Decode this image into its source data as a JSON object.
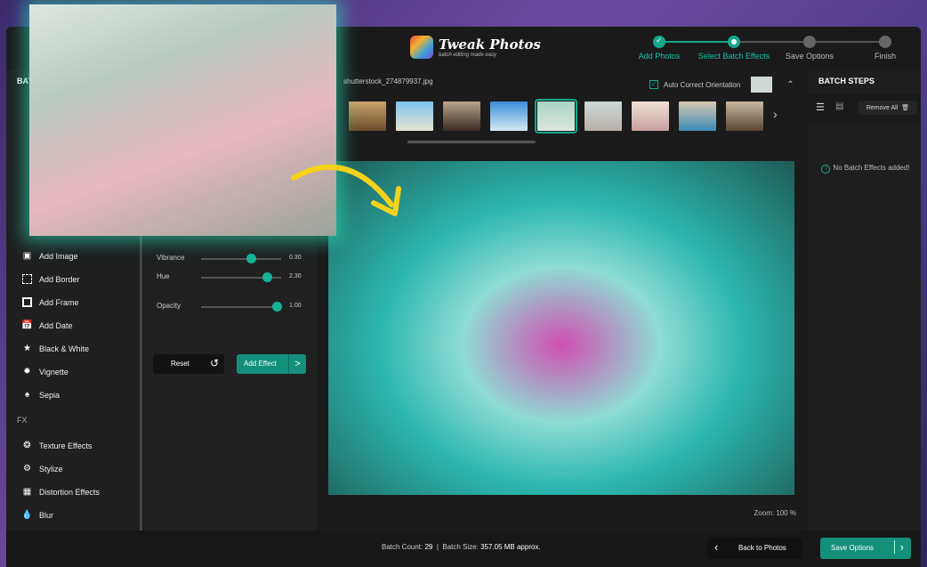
{
  "app": {
    "name": "Tweak Photos",
    "tagline": "batch editing made easy"
  },
  "steps": [
    {
      "label": "Add Photos",
      "state": "done"
    },
    {
      "label": "Select Batch Effects",
      "state": "current"
    },
    {
      "label": "Save Options",
      "state": "pending"
    },
    {
      "label": "Finish",
      "state": "pending"
    }
  ],
  "sidebar": {
    "title": "BATCH",
    "items": [
      {
        "label": "Add Image",
        "icon": "add-image-icon"
      },
      {
        "label": "Add Border",
        "icon": "border-icon"
      },
      {
        "label": "Add Frame",
        "icon": "frame-icon"
      },
      {
        "label": "Add Date",
        "icon": "calendar-icon"
      },
      {
        "label": "Black & White",
        "icon": "star-icon"
      },
      {
        "label": "Vignette",
        "icon": "vignette-icon"
      },
      {
        "label": "Sepia",
        "icon": "sepia-icon"
      }
    ],
    "fx_label": "FX",
    "fx_items": [
      {
        "label": "Texture Effects",
        "icon": "texture-icon"
      },
      {
        "label": "Stylize",
        "icon": "gear-icon"
      },
      {
        "label": "Distortion Effects",
        "icon": "grid-icon"
      },
      {
        "label": "Blur",
        "icon": "drop-icon"
      }
    ]
  },
  "settings": {
    "sliders": [
      {
        "label": "Vibrance",
        "value": "0.30",
        "fraction": 0.62
      },
      {
        "label": "Hue",
        "value": "2.30",
        "fraction": 0.82
      },
      {
        "label": "Opacity",
        "value": "1.00",
        "fraction": 0.94
      }
    ],
    "reset_label": "Reset",
    "add_effect_label": "Add Effect"
  },
  "center": {
    "filename": "shutterstock_274879937.jpg",
    "auto_correct_label": "Auto Correct Orientation",
    "auto_correct_checked": true,
    "selected_thumb": 5,
    "zoom": "Zoom: 100 %"
  },
  "right": {
    "title": "BATCH STEPS",
    "remove_all_label": "Remove  All",
    "empty_text": "No Batch Effects added!"
  },
  "bottom": {
    "count_label": "Batch Count:",
    "count": "29",
    "size_label": "Batch Size:",
    "size": "357.05 MB approx.",
    "back_label": "Back to Photos",
    "save_label": "Save Options"
  },
  "colors": {
    "accent": "#14a88c",
    "arrow": "#f5d21a"
  }
}
